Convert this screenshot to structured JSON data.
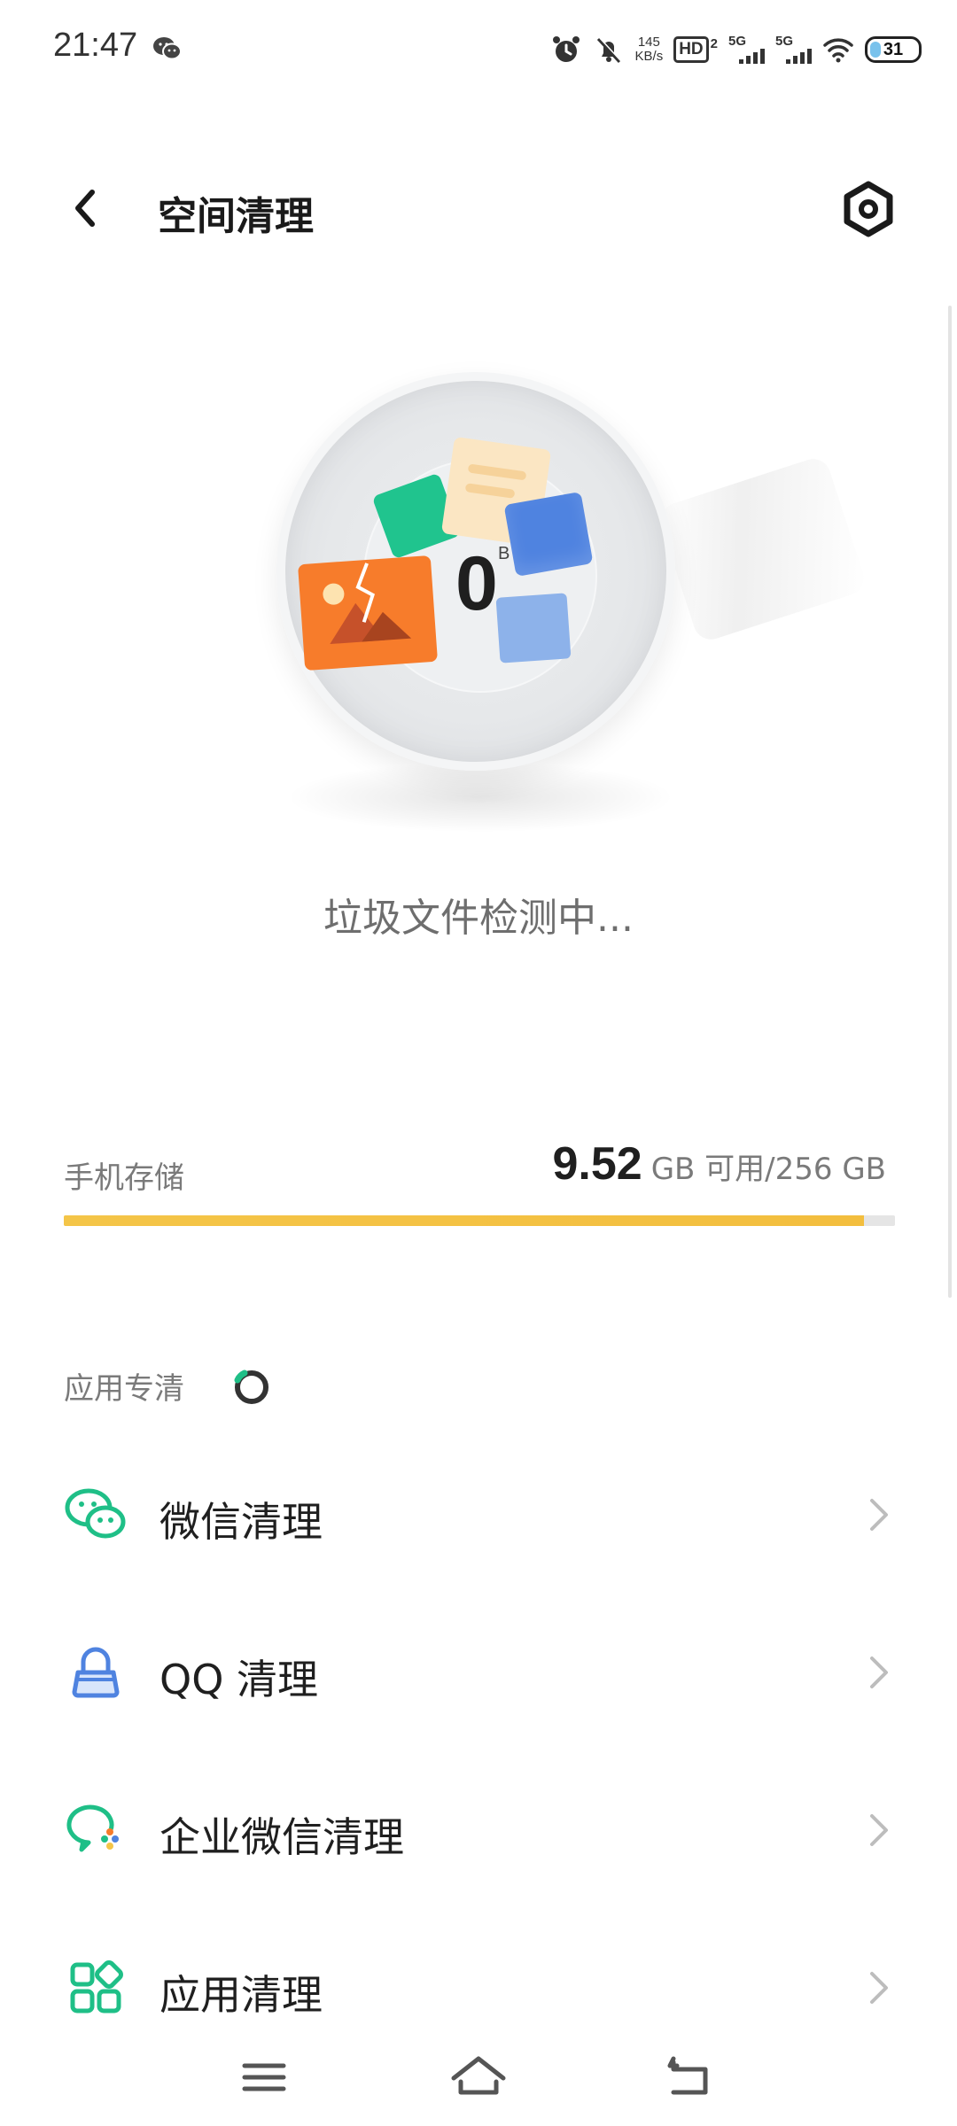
{
  "status_bar": {
    "time": "21:47",
    "net_speed_value": "145",
    "net_speed_unit": "KB/s",
    "hd_label": "HD",
    "hd_sub": "2",
    "sim1_label": "5G",
    "sim2_label": "5G",
    "battery": "31"
  },
  "header": {
    "title": "空间清理"
  },
  "hero": {
    "size_value": "0",
    "size_unit": "B",
    "scan_status": "垃圾文件检测中..."
  },
  "storage": {
    "label": "手机存储",
    "available": "9.52",
    "available_unit": "GB 可用/256 GB",
    "used_fraction": 0.963
  },
  "app_section": {
    "title": "应用专清",
    "items": [
      {
        "label": "微信清理",
        "icon": "wechat-icon"
      },
      {
        "label": "QQ 清理",
        "icon": "qq-icon"
      },
      {
        "label": "企业微信清理",
        "icon": "wecom-icon"
      },
      {
        "label": "应用清理",
        "icon": "apps-grid-icon"
      }
    ]
  },
  "colors": {
    "accent_green": "#1fbf87",
    "qq_blue": "#4f83e0",
    "storage_yellow": "#f4c548"
  }
}
